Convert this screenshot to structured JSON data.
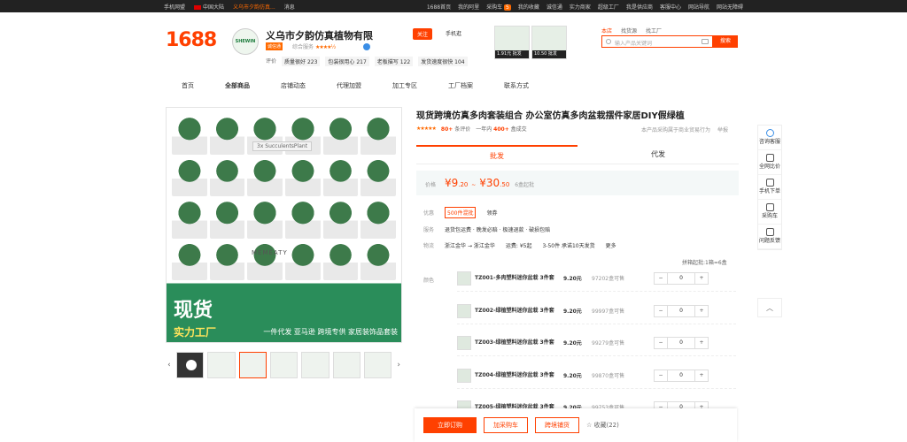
{
  "topbar": {
    "left": [
      "手机网盟",
      "中国大陆",
      "义乌市夕韵仿真...",
      "消息"
    ],
    "right": [
      "1688首页",
      "我的阿里",
      "采购车",
      "我的收藏",
      "诚信通",
      "实力商家",
      "超级工厂",
      "我是供应商",
      "客服中心",
      "网站导航",
      "网站无障碍"
    ],
    "cart_count": "5"
  },
  "header": {
    "logo": "1688",
    "shop_avatar_text": "SHEWIN",
    "shop_name": "义乌市夕韵仿真植物有限",
    "shop_tag": "诚信通",
    "shop_rating_label": "综合服务",
    "shop_stars": "★★★★½",
    "metrics": [
      {
        "label": "评价",
        "value": ""
      },
      {
        "label": "质量很好",
        "value": "223"
      },
      {
        "label": "包装很用心",
        "value": "217"
      },
      {
        "label": "老板描写",
        "value": "122"
      },
      {
        "label": "发货速度很快",
        "value": "104"
      }
    ],
    "follow": "关注",
    "mobile": "手机逛",
    "promos": [
      {
        "label": "1.91元 批发"
      },
      {
        "label": "10.50 批发"
      }
    ]
  },
  "search": {
    "tabs": [
      "本店",
      "找货源",
      "找工厂"
    ],
    "placeholder": "输入产品关键词",
    "button": "搜索"
  },
  "nav": [
    "首页",
    "全部商品",
    "店铺动态",
    "代理加盟",
    "加工专区",
    "工厂档案",
    "联系方式"
  ],
  "gallery": {
    "sign": "3x SucculentsPlant",
    "brand": "MEMEATY",
    "promo_text": "现货",
    "promo_sub": "实力工厂",
    "promo_line": "一件代发 亚马逊 跨境专供 家居装饰品套装"
  },
  "product": {
    "title": "现货跨境仿真多肉套装组合 办公室仿真多肉盆栽摆件家居DIY假绿植",
    "stars": "★★★★★",
    "reviews_count": "80+",
    "reviews_label": "条评价",
    "sold_prefix": "一年内",
    "sold_count": "400+",
    "sold_suffix": "盒成交",
    "notice": "本产品采购属于商业贸易行为",
    "report": "举报"
  },
  "tabs": [
    "批发",
    "代发"
  ],
  "price": {
    "label": "价格",
    "low_main": "¥9",
    "low_dec": ".20",
    "sep": "~",
    "high_main": "¥30",
    "high_dec": ".50",
    "moq": "6盒起批"
  },
  "info": {
    "promo_label": "优惠",
    "promo_tag": "500件混批",
    "promo_more": "领券",
    "service_label": "服务",
    "service_val": "退货包运费 · 晚发必赔 · 极速退款 · 破损包赔",
    "logistics_label": "物流",
    "logistics_from": "浙江金华",
    "logistics_to": "浙江金华",
    "logistics_fee": "运费: ¥5起",
    "logistics_time": "3-50件 承诺10天发货",
    "logistics_more": "更多"
  },
  "sku": {
    "header": "拼箱起批:1箱=6盒",
    "color_label": "颜色",
    "rows": [
      {
        "name": "TZ001-多肉塑料迷你盆栽 3件套",
        "price": "9.20元",
        "stock": "97202盒可售",
        "qty": "0"
      },
      {
        "name": "TZ002-绿植塑料迷你盆栽 3件套",
        "price": "9.20元",
        "stock": "99997盒可售",
        "qty": "0"
      },
      {
        "name": "TZ003-绿植塑料迷你盆栽 3件套",
        "price": "9.20元",
        "stock": "99279盒可售",
        "qty": "0"
      },
      {
        "name": "TZ004-绿植塑料迷你盆栽 3件套",
        "price": "9.20元",
        "stock": "99870盒可售",
        "qty": "0"
      },
      {
        "name": "TZ005-绿植塑料迷你盆栽 3件套",
        "price": "9.20元",
        "stock": "99753盒可售",
        "qty": "0"
      }
    ]
  },
  "actions": {
    "buy": "立即订购",
    "cart": "加采购车",
    "dist": "跨境铺货",
    "fav": "☆ 收藏(22)"
  },
  "sidebar": [
    "咨询客服",
    "全网比价",
    "手机下单",
    "采购车",
    "问题反馈"
  ],
  "colors": {
    "accent": "#ff4000",
    "promo_green": "#2a8d5a"
  }
}
